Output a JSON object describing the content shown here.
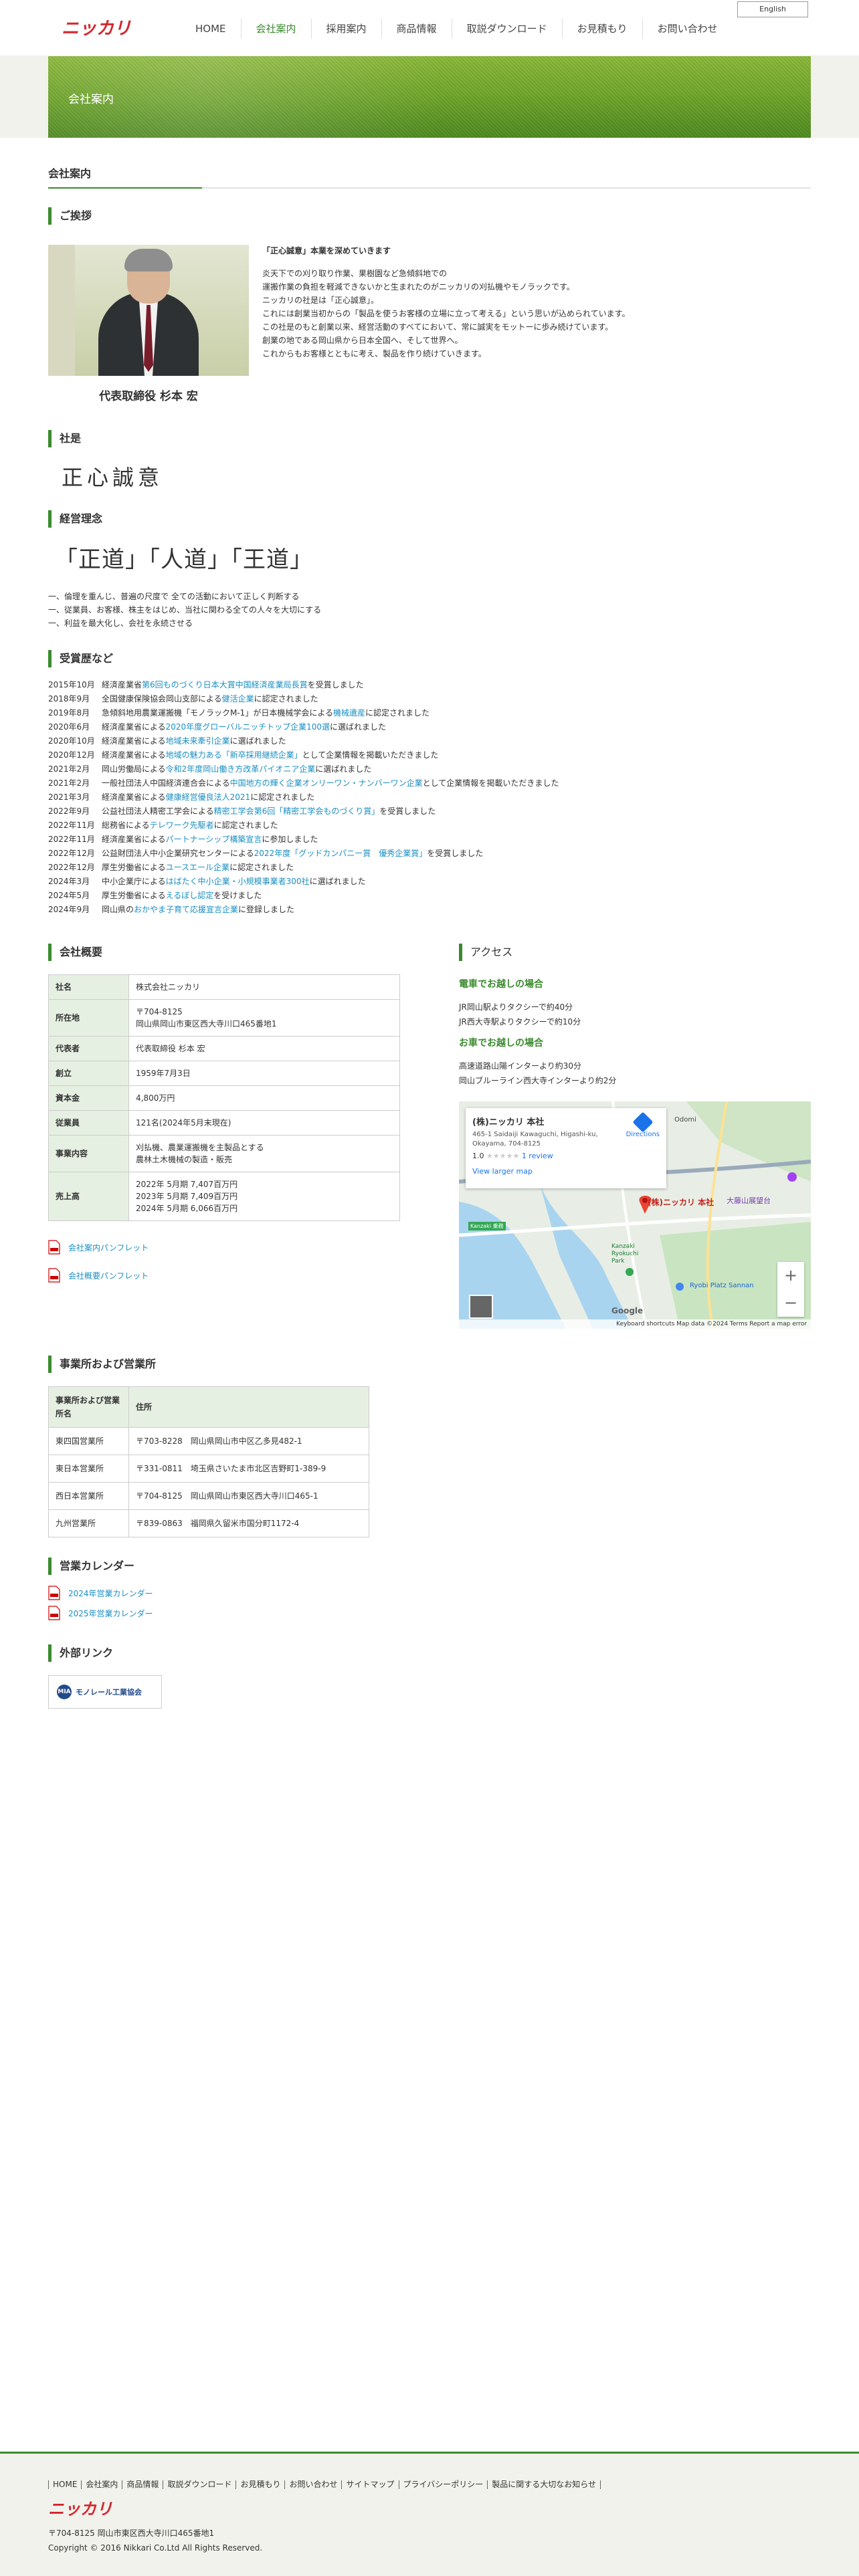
{
  "header": {
    "logo_text": "ニッカリ",
    "lang_button": "English",
    "nav": [
      {
        "label": "HOME"
      },
      {
        "label": "会社案内"
      },
      {
        "label": "採用案内"
      },
      {
        "label": "商品情報"
      },
      {
        "label": "取説ダウンロード"
      },
      {
        "label": "お見積もり"
      },
      {
        "label": "お問い合わせ"
      }
    ]
  },
  "banner": {
    "title": "会社案内"
  },
  "page_heading": "会社案内",
  "greeting": {
    "title": "ご挨拶",
    "ceo_name": "代表取締役 杉本 宏",
    "headline": "「正心誠意」本業を深めていきます",
    "lines": [
      "炎天下での刈り取り作業、果樹園など急傾斜地での",
      "運搬作業の負担を軽減できないかと生まれたのがニッカリの刈払機やモノラックです。",
      "ニッカリの社是は「正心誠意」。",
      "これには創業当初からの「製品を使うお客様の立場に立って考える」という思いが込められています。",
      "この社是のもと創業以来、経営活動のすべてにおいて、常に誠実をモットーに歩み続けています。",
      "創業の地である岡山県から日本全国へ、そして世界へ。",
      "これからもお客様とともに考え、製品を作り続けていきます。"
    ]
  },
  "motto": {
    "title": "社是",
    "text": "正心誠意"
  },
  "philosophy": {
    "title": "経営理念",
    "text": "「正道」「人道」「王道」",
    "lines": [
      "一、倫理を重んじ、普遍の尺度で 全ての活動において正しく判断する",
      "一、従業員、お客様、株主をはじめ、当社に関わる全ての人々を大切にする",
      "一、利益を最大化し、会社を永続させる"
    ]
  },
  "awards": {
    "title": "受賞歴など",
    "items": [
      {
        "date": "2015年10月",
        "pre": "経済産業省",
        "link": "第6回ものづくり日本大賞中国経済産業局長賞",
        "post": "を受賞しました"
      },
      {
        "date": "2018年9月",
        "pre": "全国健康保険協会岡山支部による",
        "link": "健活企業",
        "post": "に認定されました"
      },
      {
        "date": "2019年8月",
        "pre": "急傾斜地用農業運搬機「モノラックM-1」が日本機械学会による",
        "link": "機械遺産",
        "post": "に認定されました"
      },
      {
        "date": "2020年6月",
        "pre": "経済産業省による",
        "link": "2020年度グローバルニッチトップ企業100選",
        "post": "に選ばれました"
      },
      {
        "date": "2020年10月",
        "pre": "経済産業省による",
        "link": "地域未来牽引企業",
        "post": "に選ばれました"
      },
      {
        "date": "2020年12月",
        "pre": "経済産業省による",
        "link": "地域の魅力ある「新卒採用継続企業」",
        "post": "として企業情報を掲載いただきました"
      },
      {
        "date": "2021年2月",
        "pre": "岡山労働局による",
        "link": "令和2年度岡山働き方改革パイオニア企業",
        "post": "に選ばれました"
      },
      {
        "date": "2021年2月",
        "pre": "一般社団法人中国経済連合会による",
        "link": "中国地方の輝く企業オンリーワン・ナンバーワン企業",
        "post": "として企業情報を掲載いただきました"
      },
      {
        "date": "2021年3月",
        "pre": "経済産業省による",
        "link": "健康経営優良法人2021",
        "post": "に認定されました"
      },
      {
        "date": "2022年9月",
        "pre": "公益社団法人精密工学会による",
        "link": "精密工学会第6回「精密工学会ものづくり賞」",
        "post": "を受賞しました"
      },
      {
        "date": "2022年11月",
        "pre": "総務省による",
        "link": "テレワーク先駆者",
        "post": "に認定されました"
      },
      {
        "date": "2022年11月",
        "pre": "経済産業省による",
        "link": "パートナーシップ構築宣言",
        "post": "に参加しました"
      },
      {
        "date": "2022年12月",
        "pre": "公益財団法人中小企業研究センターによる",
        "link": "2022年度「グッドカンパニー賞　優秀企業賞」",
        "post": "を受賞しました"
      },
      {
        "date": "2022年12月",
        "pre": "厚生労働省による",
        "link": "ユースエール企業",
        "post": "に認定されました"
      },
      {
        "date": "2024年3月",
        "pre": "中小企業庁による",
        "link": "はばたく中小企業・小規模事業者300社",
        "post": "に選ばれました"
      },
      {
        "date": "2024年5月",
        "pre": "厚生労働省による",
        "link": "えるぼし認定",
        "post": "を受けました"
      },
      {
        "date": "2024年9月",
        "pre": "岡山県の",
        "link": "おかやま子育て応援宣言企業",
        "post": "に登録しました"
      }
    ]
  },
  "overview": {
    "title": "会社概要",
    "rows": [
      {
        "label": "社名",
        "lines": [
          "株式会社ニッカリ"
        ]
      },
      {
        "label": "所在地",
        "lines": [
          "〒704-8125",
          "岡山県岡山市東区西大寺川口465番地1"
        ]
      },
      {
        "label": "代表者",
        "lines": [
          "代表取締役 杉本 宏"
        ]
      },
      {
        "label": "創立",
        "lines": [
          "1959年7月3日"
        ]
      },
      {
        "label": "資本金",
        "lines": [
          "4,800万円"
        ]
      },
      {
        "label": "従業員",
        "lines": [
          "121名(2024年5月末現在)"
        ]
      },
      {
        "label": "事業内容",
        "lines": [
          "刈払機、農業運搬機を主製品とする",
          "農林土木機械の製造・販売"
        ]
      },
      {
        "label": "売上高",
        "lines": [
          "2022年 5月期 7,407百万円",
          "2023年 5月期 7,409百万円",
          "2024年 5月期 6,066百万円"
        ]
      }
    ],
    "pdf_links": [
      "会社案内パンフレット",
      "会社概要パンフレット"
    ]
  },
  "access": {
    "title": "アクセス",
    "train_head": "電車でお越しの場合",
    "train_lines": [
      "JR岡山駅よりタクシーで約40分",
      "JR西大寺駅よりタクシーで約10分"
    ],
    "car_head": "お車でお越しの場合",
    "car_lines": [
      "高速道路山陽インターより約30分",
      "岡山ブルーライン西大寺インターより約2分"
    ],
    "map": {
      "card_title": "(株)ニッカリ 本社",
      "card_addr": "465-1 Saidaiji Kawaguchi, Higashi-ku, Okayama, 704-8125",
      "rating": "1.0",
      "stars": "★★★★★",
      "reviews": "1 review",
      "large_map": "View larger map",
      "directions": "Directions",
      "pin_label": "(株)ニッカリ 本社",
      "labels": {
        "odomi": "Odomi",
        "daiso": "大藤山展望台",
        "kanzaki": "Kanzaki Ryokuchi Park",
        "ryobi": "Ryobi Platz Sannan",
        "route_badge": "Kanzaki 乗務"
      },
      "footer": "Keyboard shortcuts   Map data ©2024   Terms   Report a map error",
      "google": "Google",
      "zoom_in": "+",
      "zoom_out": "−"
    }
  },
  "offices": {
    "title": "事業所および営業所",
    "head": [
      "事業所および営業所名",
      "住所"
    ],
    "rows": [
      [
        "東四国営業所",
        "〒703-8228　岡山県岡山市中区乙多見482-1"
      ],
      [
        "東日本営業所",
        "〒331-0811　埼玉県さいたま市北区吉野町1-389-9"
      ],
      [
        "西日本営業所",
        "〒704-8125　岡山県岡山市東区西大寺川口465-1"
      ],
      [
        "九州営業所",
        "〒839-0863　福岡県久留米市国分町1172-4"
      ]
    ]
  },
  "calendar": {
    "title": "営業カレンダー",
    "links": [
      "2024年営業カレンダー",
      "2025年営業カレンダー"
    ]
  },
  "external": {
    "title": "外部リンク",
    "banner_text": "モノレール工業協会",
    "banner_mark": "MIA"
  },
  "footer": {
    "links": [
      "HOME",
      "会社案内",
      "商品情報",
      "取説ダウンロード",
      "お見積もり",
      "お問い合わせ",
      "サイトマップ",
      "プライバシーポリシー",
      "製品に関する大切なお知らせ"
    ],
    "logo_text": "ニッカリ",
    "address": "〒704-8125 岡山市東区西大寺川口465番地1",
    "copyright": "Copyright © 2016 Nikkari Co.Ltd All Rights Reserved."
  },
  "colors": {
    "accent": "#3b8b2e",
    "link": "#1a8fc2",
    "logo_red": "#d3262e"
  }
}
